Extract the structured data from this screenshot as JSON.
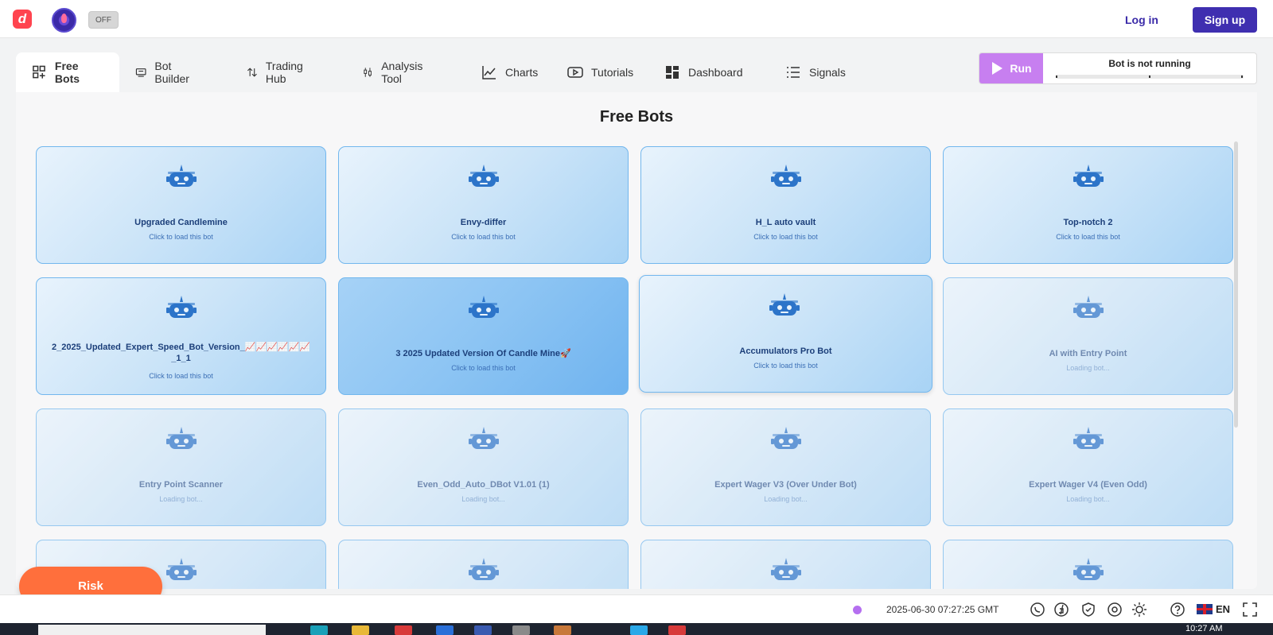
{
  "header": {
    "logo_letter": "d",
    "toggle_label": "OFF",
    "login_label": "Log in",
    "signup_label": "Sign up"
  },
  "tabs": [
    {
      "label": "Free Bots",
      "icon": "bot-add-icon",
      "active": true
    },
    {
      "label": "Bot Builder",
      "icon": "builder-icon"
    },
    {
      "label": "Trading Hub",
      "icon": "arrows-up-down-icon"
    },
    {
      "label": "Analysis Tool",
      "icon": "candles-icon"
    },
    {
      "label": "Charts",
      "icon": "chart-line-icon"
    },
    {
      "label": "Tutorials",
      "icon": "play-icon"
    },
    {
      "label": "Dashboard",
      "icon": "dashboard-icon"
    },
    {
      "label": "Signals",
      "icon": "list-icon"
    }
  ],
  "run_panel": {
    "run_label": "Run",
    "status": "Bot is not running"
  },
  "page_title": "Free Bots",
  "bots": [
    {
      "name": "Upgraded Candlemine",
      "sub": "Click to load this bot",
      "state": "ready"
    },
    {
      "name": "Envy-differ",
      "sub": "Click to load this bot",
      "state": "ready"
    },
    {
      "name": "H_L auto vault",
      "sub": "Click to load this bot",
      "state": "ready"
    },
    {
      "name": "Top-notch 2",
      "sub": "Click to load this bot",
      "state": "ready"
    },
    {
      "name": "2_2025_Updated_Expert_Speed_Bot_Version_📈📈📈📈📈📈_1_1",
      "sub": "Click to load this bot",
      "state": "ready"
    },
    {
      "name": "3 2025 Updated Version Of Candle Mine🚀",
      "sub": "Click to load this bot",
      "state": "hover"
    },
    {
      "name": "Accumulators Pro Bot",
      "sub": "Click to load this bot",
      "state": "pressed"
    },
    {
      "name": "AI with Entry Point",
      "sub": "Loading bot...",
      "state": "loading"
    },
    {
      "name": "Entry Point Scanner",
      "sub": "Loading bot...",
      "state": "loading"
    },
    {
      "name": "Even_Odd_Auto_DBot V1.01 (1)",
      "sub": "Loading bot...",
      "state": "loading"
    },
    {
      "name": "Expert Wager V3 (Over Under Bot)",
      "sub": "Loading bot...",
      "state": "loading"
    },
    {
      "name": "Expert Wager V4 (Even Odd)",
      "sub": "Loading bot...",
      "state": "loading"
    },
    {
      "name": "",
      "sub": "",
      "state": "loading"
    },
    {
      "name": "",
      "sub": "",
      "state": "loading"
    },
    {
      "name": "",
      "sub": "",
      "state": "loading"
    },
    {
      "name": "",
      "sub": "",
      "state": "loading"
    }
  ],
  "risk_label": "Risk",
  "footer": {
    "timestamp": "2025-06-30 07:27:25 GMT",
    "language": "EN",
    "icons": [
      "whatsapp-icon",
      "deriv-icon",
      "shield-icon",
      "gamstop-icon",
      "theme-icon",
      "help-icon",
      "fullscreen-icon"
    ]
  },
  "taskbar": {
    "clock": "10:27 AM"
  },
  "colors": {
    "brand_red": "#ff444f",
    "signup_purple": "#3f2fb0",
    "run_purple": "#c77ff0",
    "risk_orange": "#ff6f3c",
    "card_border": "#72b7ee"
  }
}
